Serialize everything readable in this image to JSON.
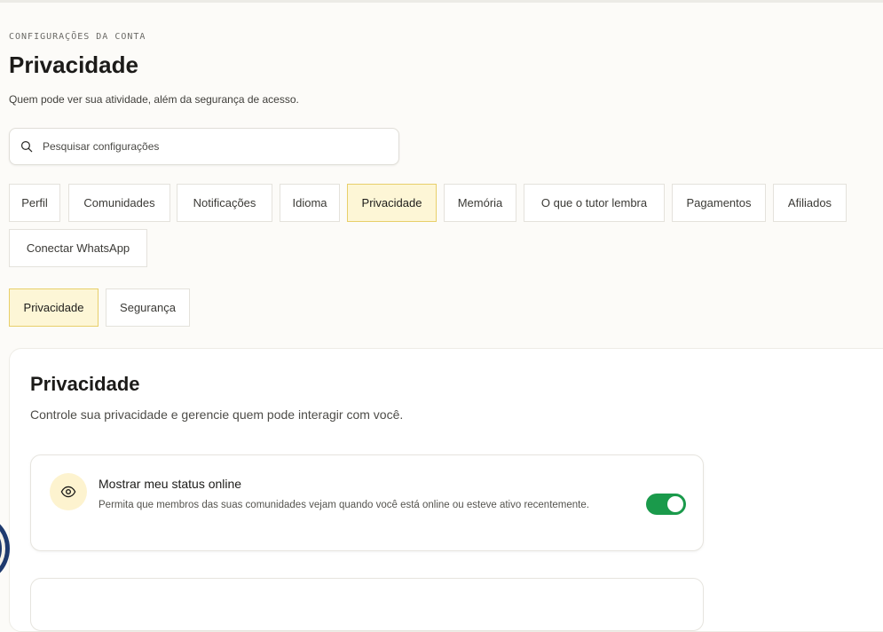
{
  "header": {
    "eyebrow": "CONFIGURAÇÕES DA CONTA",
    "title": "Privacidade",
    "subtitle": "Quem pode ver sua atividade, além da segurança de acesso."
  },
  "search": {
    "placeholder": "Pesquisar configurações",
    "icon": "search-icon"
  },
  "main_tabs": [
    {
      "label": "Perfil",
      "active": false
    },
    {
      "label": "Comunidades",
      "active": false
    },
    {
      "label": "Notificações",
      "active": false
    },
    {
      "label": "Idioma",
      "active": false
    },
    {
      "label": "Privacidade",
      "active": true
    },
    {
      "label": "Memória",
      "active": false
    },
    {
      "label": "O que o tutor lembra",
      "active": false
    },
    {
      "label": "Pagamentos",
      "active": false
    },
    {
      "label": "Afiliados",
      "active": false
    },
    {
      "label": "Conectar WhatsApp",
      "active": false
    }
  ],
  "sub_tabs": [
    {
      "label": "Privacidade",
      "active": true
    },
    {
      "label": "Segurança",
      "active": false
    }
  ],
  "section": {
    "title": "Privacidade",
    "description": "Controle sua privacidade e gerencie quem pode interagir com você."
  },
  "settings": [
    {
      "icon": "eye-icon",
      "title": "Mostrar meu status online",
      "description": "Permita que membros das suas comunidades vejam quando você está online ou esteve ativo recentemente.",
      "enabled": true
    }
  ],
  "colors": {
    "accent": "#fdf6d6",
    "accent_border": "#e8cf6a",
    "toggle_on": "#1a9a4b",
    "icon_bg": "#fdf3cf"
  }
}
